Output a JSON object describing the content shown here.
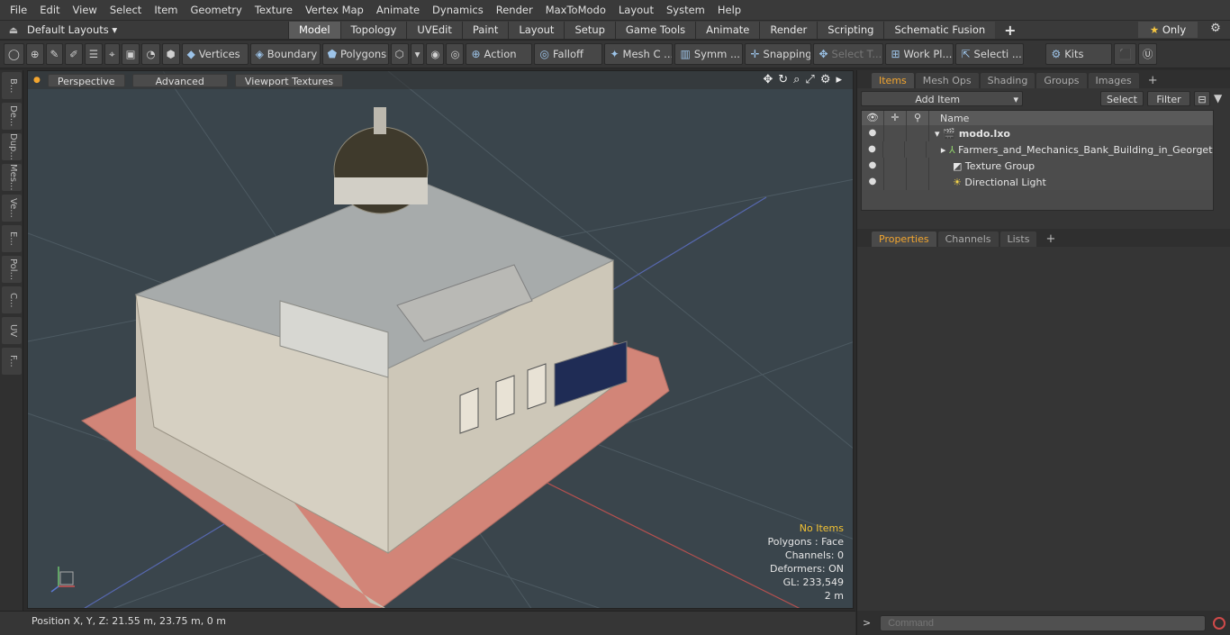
{
  "menu": [
    "File",
    "Edit",
    "View",
    "Select",
    "Item",
    "Geometry",
    "Texture",
    "Vertex Map",
    "Animate",
    "Dynamics",
    "Render",
    "MaxToModo",
    "Layout",
    "System",
    "Help"
  ],
  "layout": {
    "current": "Default Layouts ▾",
    "tabs": [
      "Model",
      "Topology",
      "UVEdit",
      "Paint",
      "Layout",
      "Setup",
      "Game Tools",
      "Animate",
      "Render",
      "Scripting",
      "Schematic Fusion"
    ],
    "active": "Model",
    "only": "Only"
  },
  "toolbar": {
    "vertices": "Vertices",
    "boundary": "Boundary",
    "polygons": "Polygons",
    "action": "Action",
    "falloff": "Falloff",
    "meshc": "Mesh C ...",
    "symm": "Symm ...",
    "snapping": "Snapping",
    "selectt": "Select T...",
    "workpl": "Work Pl...",
    "selecti": "Selecti ...",
    "kits": "Kits"
  },
  "lefttabs": [
    "B...",
    "De...",
    "Dup...",
    "Mes...",
    "Ve...",
    "E...",
    "Pol...",
    "C...",
    "UV",
    "F..."
  ],
  "viewport": {
    "perspective": "Perspective",
    "advanced": "Advanced",
    "textures": "Viewport Textures",
    "stats": {
      "items": "No Items",
      "polygons": "Polygons : Face",
      "channels": "Channels: 0",
      "deformers": "Deformers: ON",
      "gl": "GL: 233,549",
      "scale": "2 m"
    }
  },
  "status": {
    "position": "Position X, Y, Z:   21.55 m, 23.75 m, 0 m"
  },
  "items_panel": {
    "tabs": [
      "Items",
      "Mesh Ops",
      "Shading",
      "Groups",
      "Images"
    ],
    "active": "Items",
    "add_item": "Add Item",
    "select": "Select",
    "filter": "Filter",
    "col_name": "Name",
    "rows": [
      {
        "name": "modo.lxo"
      },
      {
        "name": "Farmers_and_Mechanics_Bank_Building_in_Georget ..."
      },
      {
        "name": "Texture Group"
      },
      {
        "name": "Directional Light"
      }
    ]
  },
  "props_panel": {
    "tabs": [
      "Properties",
      "Channels",
      "Lists"
    ],
    "active": "Properties"
  },
  "command": {
    "placeholder": "Command",
    "prompt": ">"
  },
  "colors": {
    "accent": "#f2a52f",
    "viewport_bg": "#3a454c",
    "warn": "#f2c233"
  }
}
